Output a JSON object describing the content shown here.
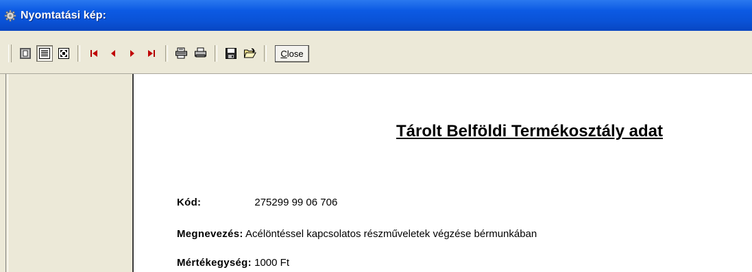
{
  "window": {
    "title": "Nyomtatási kép:"
  },
  "toolbar": {
    "buttons": [
      {
        "icon": "one-page-view-icon"
      },
      {
        "icon": "page-width-view-icon",
        "pressed": true
      },
      {
        "icon": "zoom-to-fit-icon"
      },
      {
        "icon": "first-page-icon"
      },
      {
        "icon": "previous-page-icon"
      },
      {
        "icon": "next-page-icon"
      },
      {
        "icon": "last-page-icon"
      },
      {
        "icon": "print-setup-icon"
      },
      {
        "icon": "print-icon"
      },
      {
        "icon": "save-icon"
      },
      {
        "icon": "open-icon"
      }
    ],
    "close_label_accel": "C",
    "close_label_rest": "lose"
  },
  "report": {
    "title": "Tárolt Belföldi Termékosztály adat",
    "fields": [
      {
        "label": "Kód:",
        "value": "275299 99 06 706"
      },
      {
        "label": "Megnevezés:",
        "value": " Acélöntéssel kapcsolatos részműveletek végzése bérmunkában"
      },
      {
        "label": "Mértékegység:",
        "value": " 1000 Ft"
      }
    ]
  },
  "colors": {
    "titlebar": "#0a52d6",
    "accent_red": "#c00000"
  }
}
